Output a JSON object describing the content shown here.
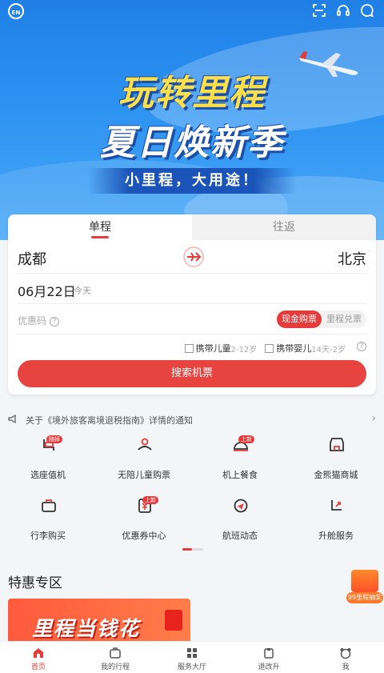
{
  "hero": {
    "title_line1": "玩转里程",
    "title_line2": "夏日焕新季",
    "ribbon": "小里程，大用途！",
    "language_badge": "EN"
  },
  "booking": {
    "tabs": [
      {
        "label": "单程",
        "active": true
      },
      {
        "label": "往返",
        "active": false
      }
    ],
    "from_city": "成都",
    "to_city": "北京",
    "date": "06月22日",
    "date_note": "今天",
    "promo_placeholder": "优惠码",
    "promo_help": "?",
    "pay_options": [
      {
        "label": "现金购票",
        "selected": true
      },
      {
        "label": "里程兑票",
        "selected": false
      }
    ],
    "passenger_options": [
      {
        "label": "携带儿童",
        "age": "2-12岁",
        "checked": false
      },
      {
        "label": "携带婴儿",
        "age": "14天-2岁",
        "checked": false
      }
    ],
    "search_button": "搜索机票"
  },
  "notice": {
    "text": "关于《境外旅客离境退税指南》详情的通知"
  },
  "services": [
    {
      "label": "选座值机",
      "badge": "随掉",
      "icon": "seat-checkin-icon"
    },
    {
      "label": "无陪儿童购票",
      "badge": "",
      "icon": "unaccompanied-child-icon"
    },
    {
      "label": "机上餐食",
      "badge": "上新",
      "icon": "meal-icon"
    },
    {
      "label": "金熊猫商城",
      "badge": "",
      "icon": "store-icon"
    },
    {
      "label": "行李购买",
      "badge": "",
      "icon": "luggage-icon"
    },
    {
      "label": "优惠券中心",
      "badge": "上新",
      "icon": "coupon-icon"
    },
    {
      "label": "航班动态",
      "badge": "",
      "icon": "flight-status-icon"
    },
    {
      "label": "升舱服务",
      "badge": "",
      "icon": "upgrade-icon"
    }
  ],
  "specials": {
    "title": "特惠专区",
    "banner_text": "里程当钱花",
    "lottery_label": "99里程抽奖"
  },
  "bottom_nav": [
    {
      "label": "首页",
      "active": true
    },
    {
      "label": "我的行程",
      "active": false
    },
    {
      "label": "服务大厅",
      "active": false
    },
    {
      "label": "退改升",
      "active": false
    },
    {
      "label": "我",
      "active": false
    }
  ],
  "colors": {
    "accent": "#e53b3b",
    "hero_blue": "#2d93f2",
    "title_yellow": "#fde047"
  }
}
